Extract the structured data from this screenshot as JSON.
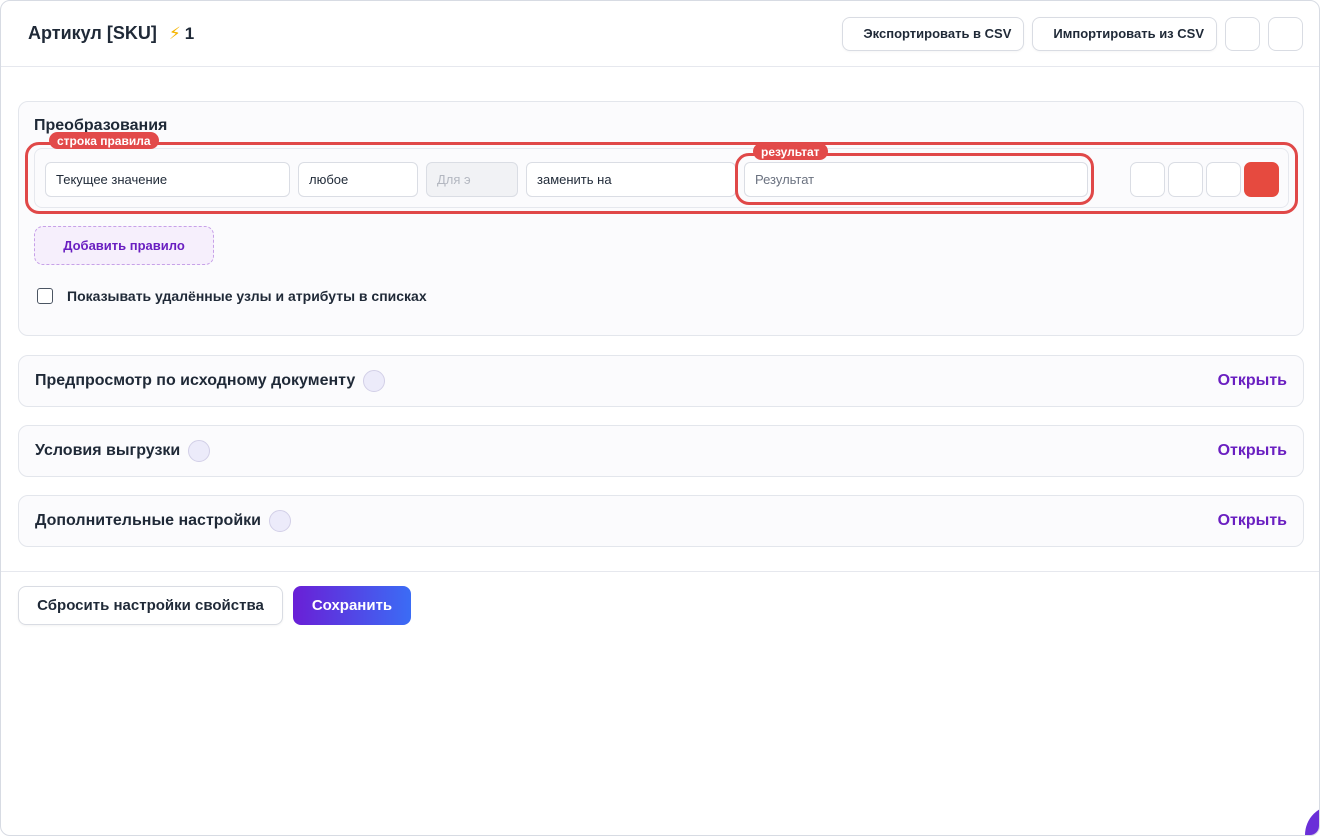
{
  "header": {
    "title": "Артикул [SKU]",
    "bolt_icon": "⚡",
    "bolt_count": "1",
    "export_label": "Экспортировать в CSV",
    "import_label": "Импортировать из CSV"
  },
  "rules": {
    "title": "Преобразования",
    "row_tag": "строка правила",
    "result_tag": "результат",
    "row": {
      "source_value": "Текущее значение",
      "match_mode": "любое",
      "pattern_placeholder": "Для э",
      "action": "заменить на",
      "result_placeholder": "Результат"
    },
    "add_rule_label": "Добавить правило",
    "show_deleted_label": "Показывать удалённые узлы и атрибуты в списках",
    "show_deleted_checked": false
  },
  "sections": [
    {
      "title": "Предпросмотр по исходному документу",
      "action": "Открыть"
    },
    {
      "title": "Условия выгрузки",
      "action": "Открыть"
    },
    {
      "title": "Дополнительные настройки",
      "action": "Открыть"
    }
  ],
  "footer": {
    "reset_label": "Сбросить настройки свойства",
    "save_label": "Сохранить"
  },
  "colors": {
    "accent": "#6a1fc1",
    "danger": "#e24a4a",
    "save_gradient_start": "#6a1fd6",
    "save_gradient_end": "#3b6cf5"
  }
}
